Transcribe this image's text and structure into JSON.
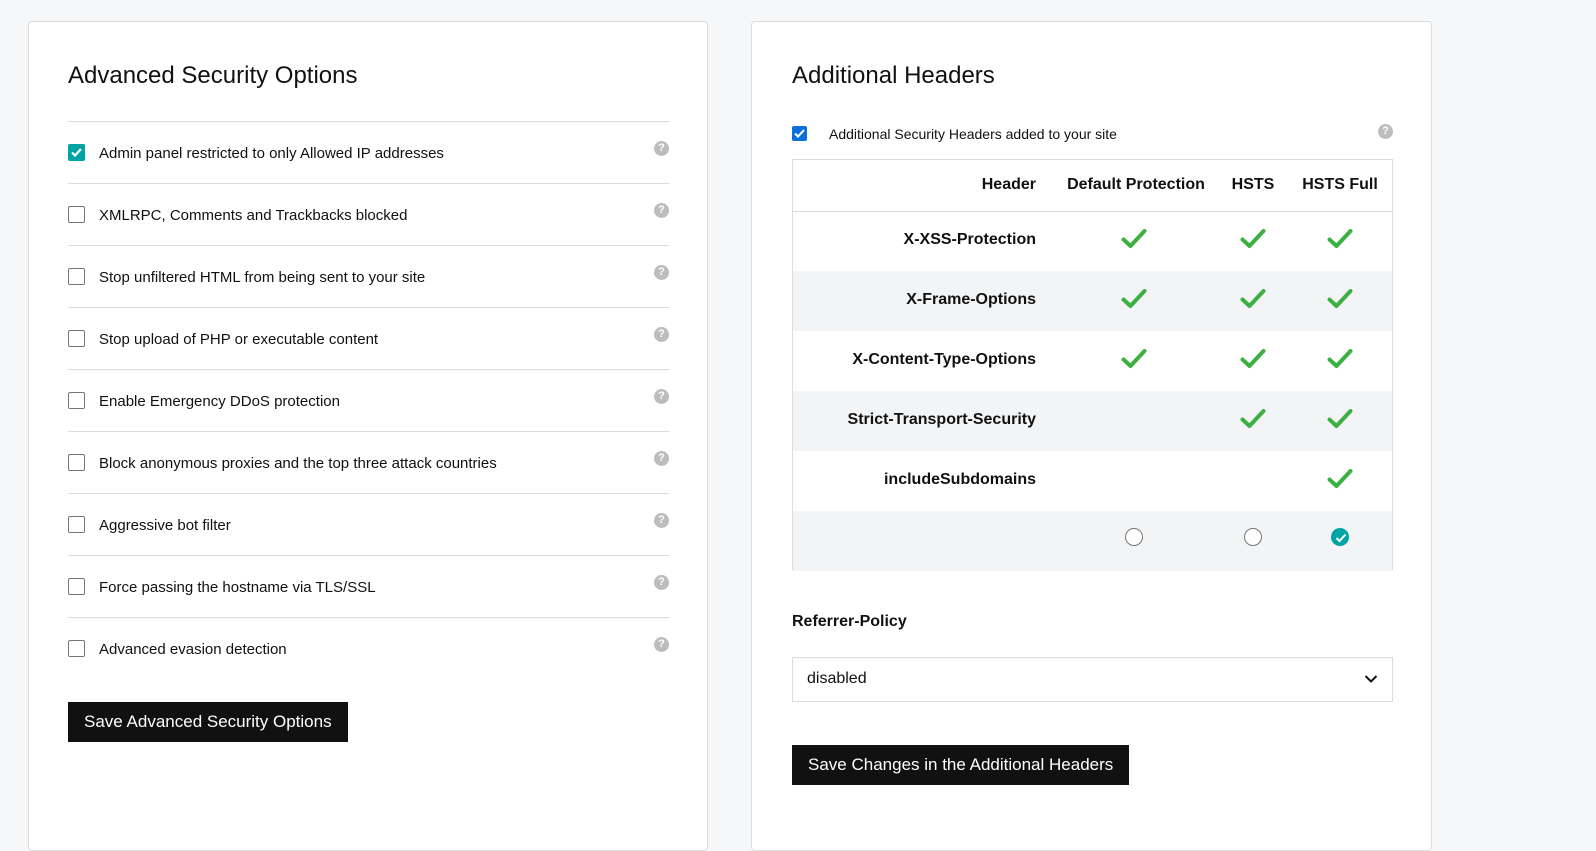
{
  "advanced": {
    "title": "Advanced Security Options",
    "options": [
      {
        "label": "Admin panel restricted to only Allowed IP addresses",
        "checked": true
      },
      {
        "label": "XMLRPC, Comments and Trackbacks blocked",
        "checked": false
      },
      {
        "label": "Stop unfiltered HTML from being sent to your site",
        "checked": false
      },
      {
        "label": "Stop upload of PHP or executable content",
        "checked": false
      },
      {
        "label": "Enable Emergency DDoS protection",
        "checked": false
      },
      {
        "label": "Block anonymous proxies and the top three attack countries",
        "checked": false
      },
      {
        "label": "Aggressive bot filter",
        "checked": false
      },
      {
        "label": "Force passing the hostname via TLS/SSL",
        "checked": false
      },
      {
        "label": "Advanced evasion detection",
        "checked": false
      }
    ],
    "help_glyph": "?",
    "save_label": "Save Advanced Security Options"
  },
  "headers": {
    "title": "Additional Headers",
    "security_headers_label": "Additional Security Headers added to your site",
    "security_headers_checked": true,
    "help_glyph": "?",
    "table": {
      "columns": [
        "Header",
        "Default Protection",
        "HSTS",
        "HSTS Full"
      ],
      "rows": [
        {
          "name": "X-XSS-Protection",
          "default": true,
          "hsts": true,
          "full": true
        },
        {
          "name": "X-Frame-Options",
          "default": true,
          "hsts": true,
          "full": true
        },
        {
          "name": "X-Content-Type-Options",
          "default": true,
          "hsts": true,
          "full": true
        },
        {
          "name": "Strict-Transport-Security",
          "default": false,
          "hsts": true,
          "full": true
        },
        {
          "name": "includeSubdomains",
          "default": false,
          "hsts": false,
          "full": true
        }
      ],
      "selected_option": "HSTS Full"
    },
    "referrer_label": "Referrer-Policy",
    "referrer_value": "disabled",
    "save_label": "Save Changes in the Additional Headers"
  },
  "colors": {
    "teal": "#00a4a6",
    "check_green": "#3cb043",
    "blue_checkbox": "#0b6fd9",
    "button_dark": "#111111"
  },
  "icons": {
    "help": "question-circle-icon",
    "check": "checkmark-icon",
    "chevron": "chevron-down-icon"
  }
}
